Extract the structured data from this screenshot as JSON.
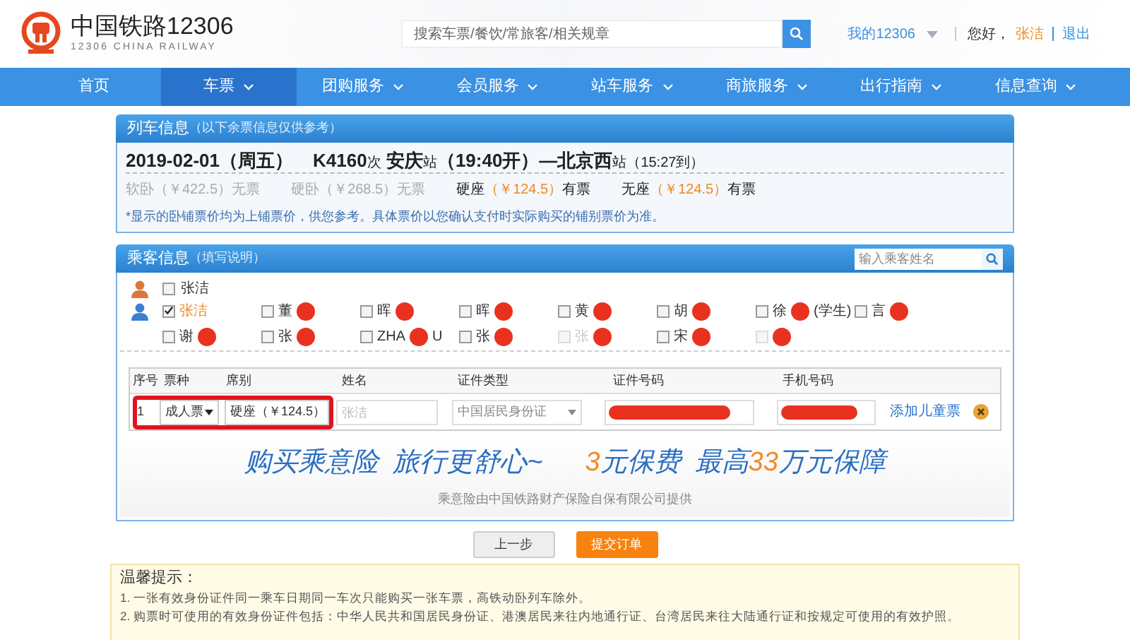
{
  "header": {
    "logo_title": "中国铁路12306",
    "logo_subtitle": "12306 CHINA RAILWAY",
    "search": {
      "placeholder": "搜索车票/餐饮/常旅客/相关规章"
    },
    "my_account": "我的12306",
    "greeting": "您好，",
    "user_name": "张洁",
    "logout": "退出"
  },
  "nav": [
    {
      "label": "首页",
      "selected": false,
      "dropdown": false
    },
    {
      "label": "车票",
      "selected": true,
      "dropdown": true
    },
    {
      "label": "团购服务",
      "selected": false,
      "dropdown": true
    },
    {
      "label": "会员服务",
      "selected": false,
      "dropdown": true
    },
    {
      "label": "站车服务",
      "selected": false,
      "dropdown": true
    },
    {
      "label": "商旅服务",
      "selected": false,
      "dropdown": true
    },
    {
      "label": "出行指南",
      "selected": false,
      "dropdown": true
    },
    {
      "label": "信息查询",
      "selected": false,
      "dropdown": true
    }
  ],
  "train_info": {
    "title": "列车信息",
    "subtitle": "（以下余票信息仅供参考）",
    "date": "2019-02-01（周五）",
    "train_no": "K4160",
    "train_suffix": "次",
    "from": "安庆",
    "station_suffix_from": "站",
    "depart": "（19:40开）—",
    "to": "北京西",
    "station_suffix_to": "站",
    "arrive": "（15:27到）",
    "seats": [
      {
        "name": "软卧",
        "price": "（￥422.5）",
        "availability": "无票",
        "available": false
      },
      {
        "name": "硬卧",
        "price": "（￥268.5）",
        "availability": "无票",
        "available": false
      },
      {
        "name": "硬座",
        "price": "（￥124.5）",
        "availability": "有票",
        "available": true
      },
      {
        "name": "无座",
        "price": "（￥124.5）",
        "availability": "有票",
        "available": true
      }
    ],
    "note": "*显示的卧铺票价均为上铺票价，供您参考。具体票价以您确认支付时实际购买的铺别票价为准。"
  },
  "passengers": {
    "title": "乘客信息",
    "subtitle": "（填写说明）",
    "search": {
      "placeholder": "输入乘客姓名"
    },
    "self": {
      "name": "张洁",
      "checked": false
    },
    "list": [
      {
        "name": "张洁",
        "checked": true,
        "disabled": false,
        "redacted": false
      },
      {
        "name": "董",
        "checked": false,
        "disabled": false,
        "redacted": true
      },
      {
        "name": "晖",
        "checked": false,
        "disabled": false,
        "redacted": true
      },
      {
        "name": "晖",
        "checked": false,
        "disabled": false,
        "redacted": true
      },
      {
        "name": "黄",
        "checked": false,
        "disabled": false,
        "redacted": true
      },
      {
        "name": "胡",
        "checked": false,
        "disabled": false,
        "redacted": true
      },
      {
        "name": "徐",
        "suffix": "(学生)",
        "checked": false,
        "disabled": false,
        "redacted": true
      },
      {
        "name": "言",
        "checked": false,
        "disabled": false,
        "redacted": true
      },
      {
        "name": "谢",
        "checked": false,
        "disabled": false,
        "redacted": true
      },
      {
        "name": "张",
        "checked": false,
        "disabled": false,
        "redacted": true
      },
      {
        "name": "ZHA",
        "suffix": "U",
        "checked": false,
        "disabled": false,
        "redacted": true
      },
      {
        "name": "张",
        "checked": false,
        "disabled": false,
        "redacted": true
      },
      {
        "name": "张",
        "checked": false,
        "disabled": true,
        "redacted": true
      },
      {
        "name": "宋",
        "checked": false,
        "disabled": false,
        "redacted": true
      },
      {
        "checked": false,
        "disabled": true,
        "redacted": true
      }
    ]
  },
  "ticket_table": {
    "columns": [
      "序号",
      "票种",
      "席别",
      "姓名",
      "证件类型",
      "证件号码",
      "手机号码"
    ],
    "rows": [
      {
        "index": "1",
        "ticket_type": "成人票",
        "seat": "硬座（￥124.5）",
        "name_placeholder": "张洁",
        "id_type": "中国居民身份证",
        "id_redacted": true,
        "phone_redacted": true,
        "add_child": "添加儿童票",
        "highlighted": true
      }
    ]
  },
  "insurance": {
    "slogan_1": "购买乘意险",
    "slogan_2": "旅行更舒心~",
    "fee_number": "3",
    "fee_text": "元保费",
    "max_prefix": "最高",
    "max_number": "33",
    "max_suffix": "万元保障",
    "provider": "乘意险由中国铁路财产保险自保有限公司提供"
  },
  "buttons": {
    "back": "上一步",
    "submit": "提交订单"
  },
  "tips": {
    "title": "温馨提示：",
    "items": [
      "1. 一张有效身份证件同一乘车日期同一车次只能购买一张车票，高铁动卧列车除外。",
      "2. 购票时可使用的有效身份证件包括：中华人民共和国居民身份证、港澳居民来往内地通行证、台湾居民来往大陆通行证和按规定可使用的有效护照。"
    ]
  }
}
